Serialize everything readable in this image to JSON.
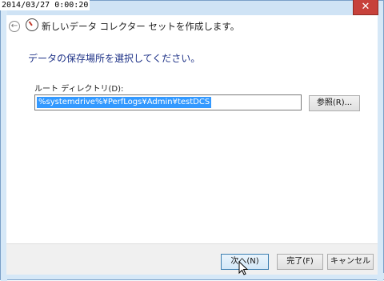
{
  "timestamp": "2014/03/27 0:00:20",
  "window": {
    "close_glyph": "✕",
    "title": "新しいデータ コレクター セットを作成します。",
    "back_icon": "back-arrow-icon",
    "app_icon": "performance-monitor-icon"
  },
  "main": {
    "instruction": "データの保存場所を選択してください。",
    "root_dir_label": "ルート ディレクトリ(D):",
    "root_dir_value": "%systemdrive%¥PerfLogs¥Admin¥testDCS",
    "browse_label": "参照(R)..."
  },
  "footer": {
    "next_label": "次へ(N)",
    "finish_label": "完了(F)",
    "cancel_label": "キャンセル"
  },
  "colors": {
    "accent_text": "#1e3287",
    "selection": "#3399ff",
    "close_button": "#c7413b"
  }
}
